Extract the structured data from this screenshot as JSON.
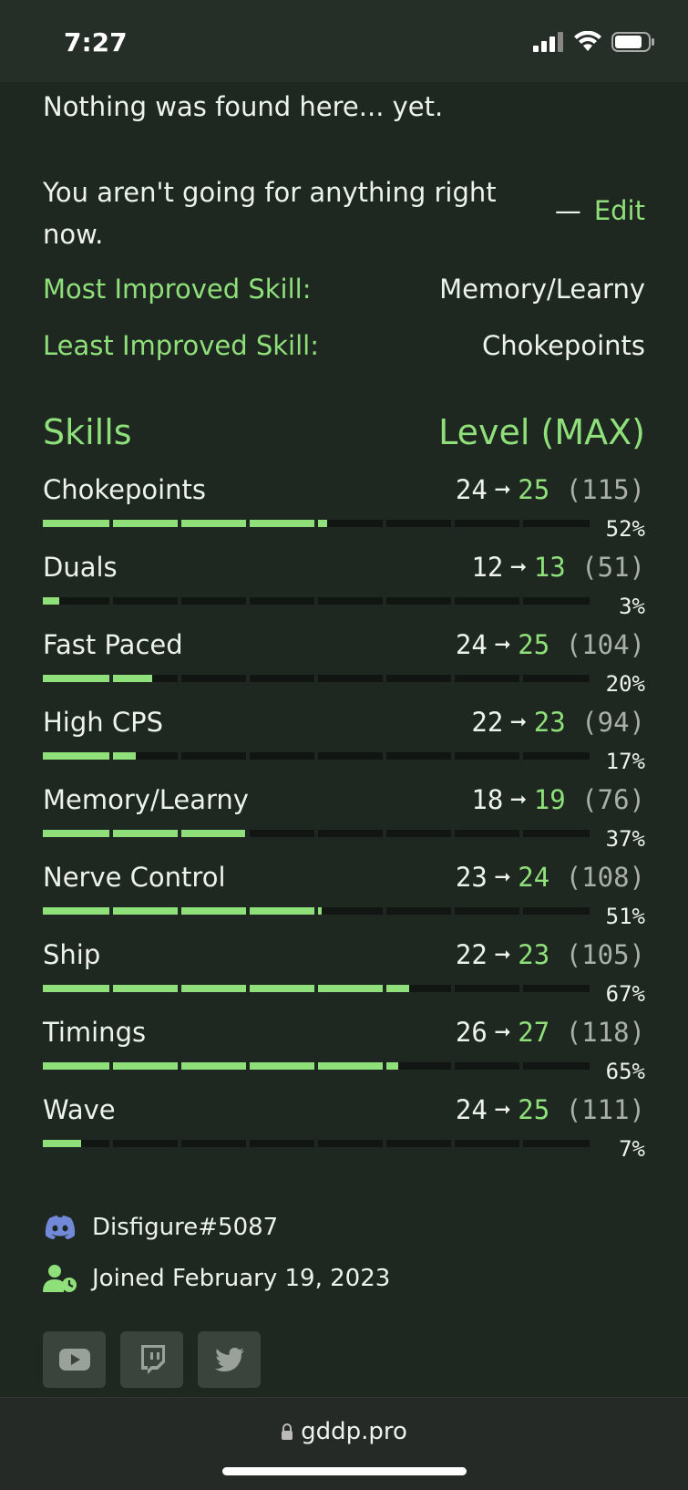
{
  "status_bar": {
    "time": "7:27"
  },
  "goals": {
    "nothing_found": "Nothing was found here... yet.",
    "not_going": "You aren't going for anything right now.",
    "edit_dash": "—",
    "edit_label": "Edit"
  },
  "stats": {
    "most_label": "Most Improved Skill:",
    "most_value": "Memory/Learny",
    "least_label": "Least Improved Skill:",
    "least_value": "Chokepoints"
  },
  "skills_header": {
    "left": "Skills",
    "right": "Level (MAX)"
  },
  "skills": [
    {
      "name": "Chokepoints",
      "from": "24",
      "to": "25",
      "max": "(115)",
      "pct": "52%",
      "progress": 0.52
    },
    {
      "name": "Duals",
      "from": "12",
      "to": "13",
      "max": "(51)",
      "pct": "3%",
      "progress": 0.03
    },
    {
      "name": "Fast Paced",
      "from": "24",
      "to": "25",
      "max": "(104)",
      "pct": "20%",
      "progress": 0.2
    },
    {
      "name": "High CPS",
      "from": "22",
      "to": "23",
      "max": "(94)",
      "pct": "17%",
      "progress": 0.17
    },
    {
      "name": "Memory/Learny",
      "from": "18",
      "to": "19",
      "max": "(76)",
      "pct": "37%",
      "progress": 0.37
    },
    {
      "name": "Nerve Control",
      "from": "23",
      "to": "24",
      "max": "(108)",
      "pct": "51%",
      "progress": 0.51
    },
    {
      "name": "Ship",
      "from": "22",
      "to": "23",
      "max": "(105)",
      "pct": "67%",
      "progress": 0.67
    },
    {
      "name": "Timings",
      "from": "26",
      "to": "27",
      "max": "(118)",
      "pct": "65%",
      "progress": 0.65
    },
    {
      "name": "Wave",
      "from": "24",
      "to": "25",
      "max": "(111)",
      "pct": "7%",
      "progress": 0.07
    }
  ],
  "profile": {
    "discord": "Disfigure#5087",
    "joined": "Joined February 19, 2023"
  },
  "socials": [
    "youtube-icon",
    "twitch-icon",
    "twitter-icon"
  ],
  "browser": {
    "url": "gddp.pro"
  },
  "colors": {
    "accent": "#8fe07a",
    "background": "#1e2820",
    "discord": "#7289da"
  }
}
